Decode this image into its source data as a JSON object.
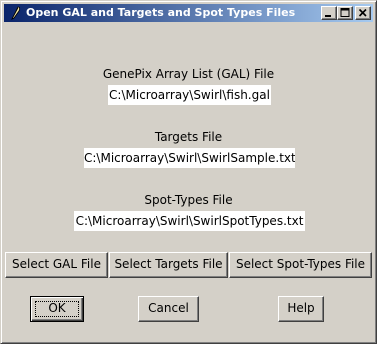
{
  "window": {
    "title": "Open GAL and Targets and Spot Types Files",
    "icon": "feather-icon",
    "controls": {
      "minimize": "minimize-icon",
      "maximize": "maximize-icon",
      "close": "close-icon"
    }
  },
  "gal": {
    "label": "GenePix Array List (GAL) File",
    "path": "C:\\Microarray\\Swirl\\fish.gal"
  },
  "targets": {
    "label": "Targets File",
    "path": "C:\\Microarray\\Swirl\\SwirlSample.txt"
  },
  "spot_types": {
    "label": "Spot-Types File",
    "path": "C:\\Microarray\\Swirl\\SwirlSpotTypes.txt"
  },
  "select_buttons": {
    "gal": "Select GAL File",
    "targets": "Select Targets File",
    "spot_types": "Select Spot-Types File"
  },
  "actions": {
    "ok": "OK",
    "cancel": "Cancel",
    "help": "Help"
  },
  "colors": {
    "face": "#d4d0c8",
    "title_active_start": "#0a246a",
    "title_active_end": "#a6caf0",
    "field_bg": "#ffffff"
  }
}
